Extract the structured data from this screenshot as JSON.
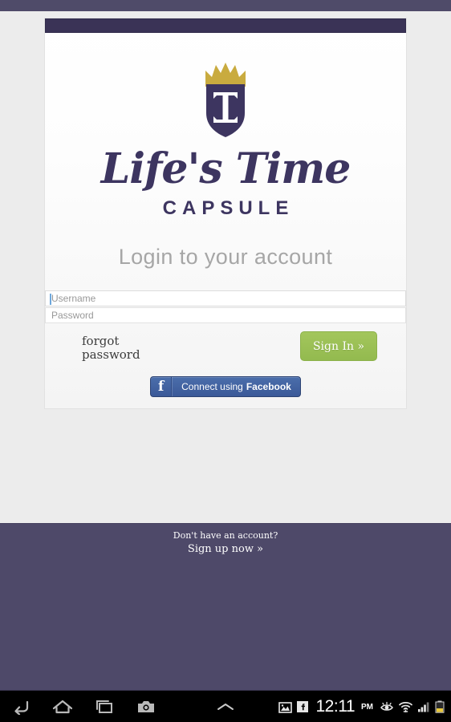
{
  "brand": {
    "logo_icon": "crown-shield-logo",
    "script_name": "Life's Time",
    "sub_name": "CAPSULE",
    "colors": {
      "purple": "#3d3560",
      "crown_gold": "#c9ab3f",
      "footer_purple": "#4e4969",
      "header_purple": "#3a3356",
      "green_button": "#93ba4f",
      "facebook_blue": "#3b5998"
    }
  },
  "login": {
    "heading": "Login to your account",
    "username": {
      "placeholder": "Username",
      "value": ""
    },
    "password": {
      "placeholder": "Password",
      "value": ""
    },
    "forgot_label": "forgot\npassword",
    "forgot_line1": "forgot",
    "forgot_line2": "password",
    "signin_label": "Sign In »",
    "facebook_icon": "facebook-f-icon",
    "facebook_label_prefix": "Connect using",
    "facebook_label_bold": "Facebook"
  },
  "footer": {
    "line1": "Don't have an account?",
    "line2": "Sign up now »"
  },
  "navbar": {
    "back_icon": "back-arrow-icon",
    "home_icon": "home-icon",
    "recents_icon": "recent-apps-icon",
    "screenshot_icon": "camera-icon",
    "expand_icon": "chevron-up-icon"
  },
  "statusbar": {
    "gallery_icon": "image-notification-icon",
    "facebook_icon": "facebook-notification-icon",
    "time": "12:11",
    "meridiem": "PM",
    "smartstay_icon": "eye-icon",
    "wifi_icon": "wifi-icon",
    "signal_icon": "signal-bars-icon",
    "battery_icon": "battery-icon"
  }
}
